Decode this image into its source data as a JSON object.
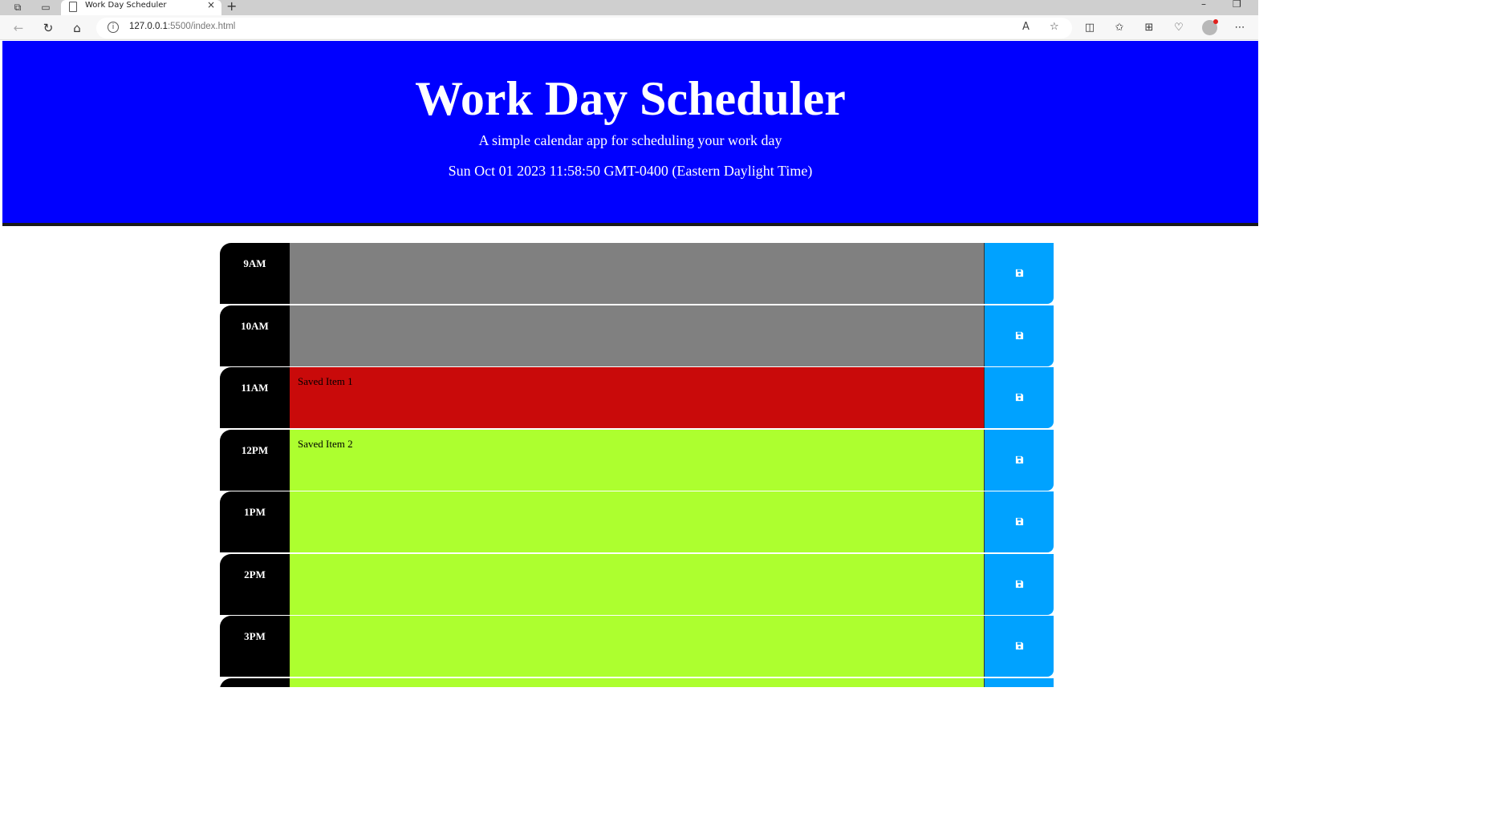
{
  "browser": {
    "tab_title": "Work Day Scheduler",
    "tab_close": "×",
    "new_tab": "+",
    "url_host": "127.0.0.1",
    "url_rest": ":5500/index.html"
  },
  "header": {
    "title": "Work Day Scheduler",
    "lead": "A simple calendar app for scheduling your work day",
    "current_date": "Sun Oct 01 2023 11:58:50 GMT-0400 (Eastern Daylight Time)"
  },
  "timeblocks": [
    {
      "hour": "9AM",
      "text": "",
      "status": "past"
    },
    {
      "hour": "10AM",
      "text": "",
      "status": "past"
    },
    {
      "hour": "11AM",
      "text": "Saved Item 1",
      "status": "present"
    },
    {
      "hour": "12PM",
      "text": "Saved Item 2",
      "status": "future"
    },
    {
      "hour": "1PM",
      "text": "",
      "status": "future"
    },
    {
      "hour": "2PM",
      "text": "",
      "status": "future"
    },
    {
      "hour": "3PM",
      "text": "",
      "status": "future"
    },
    {
      "hour": "",
      "text": "",
      "status": "future"
    }
  ],
  "colors": {
    "header_bg": "#0000ff",
    "past": "#808080",
    "present": "#c90a0a",
    "future": "#adff2f",
    "save_bg": "#00a2ff",
    "hour_bg": "#000000"
  },
  "icons": {
    "save": "floppy-disk-icon"
  }
}
